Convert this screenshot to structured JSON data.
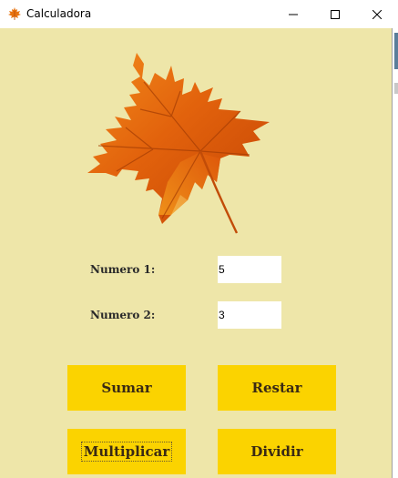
{
  "window": {
    "title": "Calculadora",
    "icon": "maple-leaf-icon",
    "controls": [
      "minimize-icon",
      "maximize-icon",
      "close-icon"
    ]
  },
  "form": {
    "image": "maple-leaf",
    "fields": [
      {
        "label": "Numero 1:",
        "value": "5"
      },
      {
        "label": "Numero 2:",
        "value": "3"
      }
    ],
    "buttons": {
      "sumar": "Sumar",
      "restar": "Restar",
      "multiplicar": "Multiplicar",
      "dividir": "Dividir"
    }
  },
  "colors": {
    "background": "#eee6a9",
    "button": "#fbd300",
    "leaf": "#e2620c"
  }
}
